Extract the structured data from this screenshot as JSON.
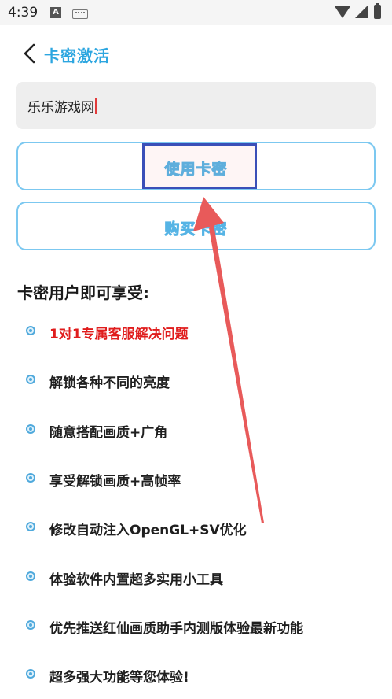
{
  "status_bar": {
    "time": "4:39",
    "notif_icon": "A"
  },
  "header": {
    "title": "卡密激活"
  },
  "input": {
    "value": "乐乐游戏网"
  },
  "buttons": {
    "use_card": "使用卡密",
    "buy_card": "购买卡密"
  },
  "benefits": {
    "title": "卡密用户即可享受:",
    "items": [
      {
        "text": "1对1专属客服解决问题",
        "highlight": true
      },
      {
        "text": "解锁各种不同的亮度"
      },
      {
        "text": "随意搭配画质+广角"
      },
      {
        "text": "享受解锁画质+高帧率"
      },
      {
        "text": "修改自动注入OpenGL+SV优化"
      },
      {
        "text": "体验软件内置超多实用小工具"
      },
      {
        "text": "优先推送红仙画质助手内测版体验最新功能"
      },
      {
        "text": "超多强大功能等您体验!"
      }
    ]
  },
  "colors": {
    "accent": "#2ca6e0",
    "highlight_text": "#e01c1c",
    "annotation_arrow": "#e85a5a",
    "annotation_box": "#3a4fb8"
  }
}
